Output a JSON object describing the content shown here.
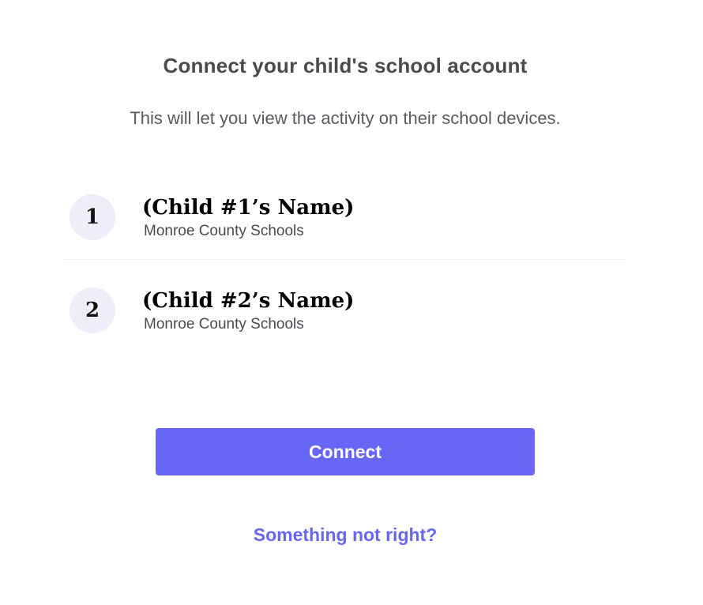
{
  "header": {
    "title": "Connect your child's school account",
    "subtitle": "This will let you view the activity on their school devices."
  },
  "children": [
    {
      "number": "1",
      "name": "(Child #1’s Name)",
      "school": "Monroe County Schools"
    },
    {
      "number": "2",
      "name": "(Child #2’s Name)",
      "school": "Monroe County Schools"
    }
  ],
  "actions": {
    "connect_label": "Connect",
    "help_link": "Something not right?"
  },
  "colors": {
    "accent": "#6766f6",
    "circle_bg": "#eeeefb",
    "title_text": "#4a4a4f"
  }
}
